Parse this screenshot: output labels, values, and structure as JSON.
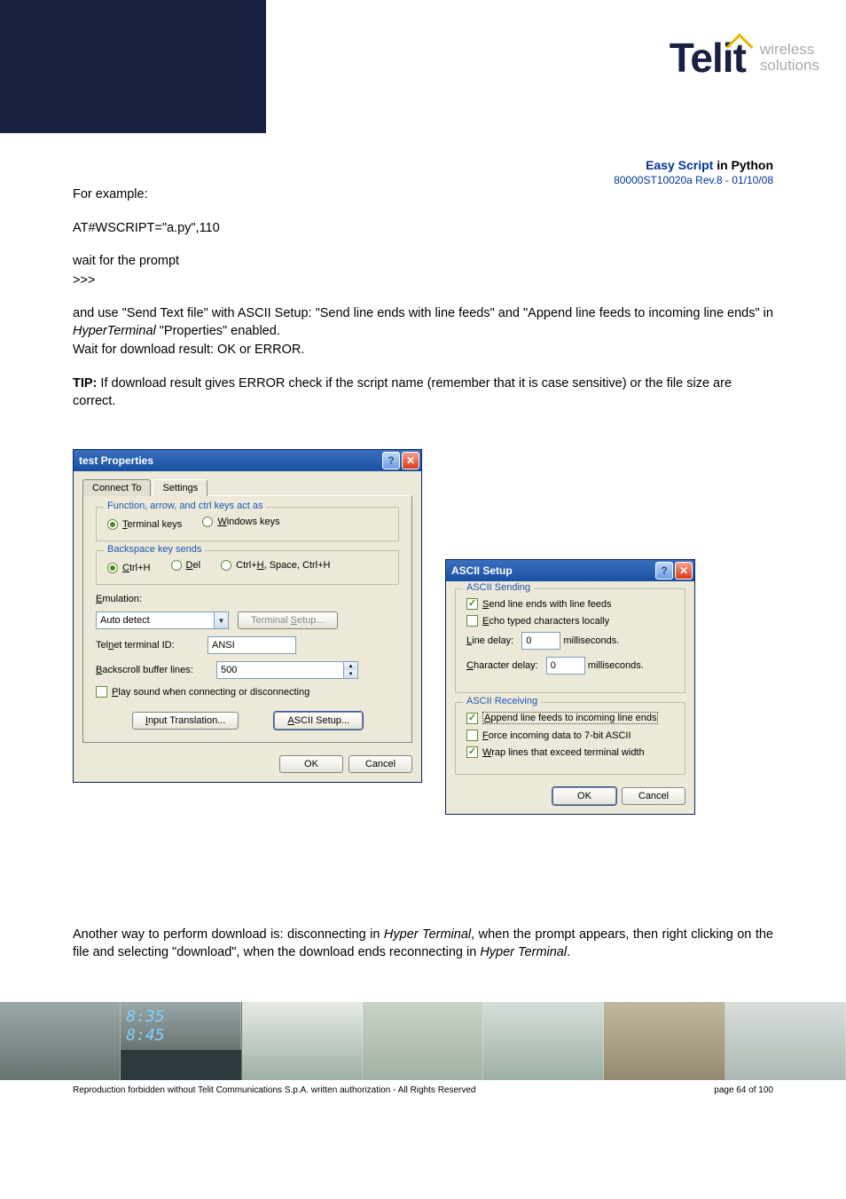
{
  "logo": {
    "brand": "Telit",
    "sub1": "wireless",
    "sub2": "solutions"
  },
  "meta": {
    "title_prefix": "Easy Script",
    "title_suffix": " in Python",
    "rev": "80000ST10020a Rev.8 - 01/10/08"
  },
  "body": {
    "p1": "For example:",
    "p2": "AT#WSCRIPT=\"a.py\",110",
    "p3a": "wait for the prompt",
    "p3b": ">>>",
    "p4": "and use \"Send Text file\" with ASCII Setup: \"Send line ends with line feeds\" and \"Append line feeds to incoming line ends\" in ",
    "p4i": "HyperTerminal",
    "p4b": " \"Properties\" enabled.",
    "p5": "Wait for download result: OK or ERROR.",
    "tip_label": "TIP:",
    "tip_text": " If download result gives ERROR check if the script name (remember that it is case sensitive) or the file size are correct.",
    "after1": "Another way to perform download is: disconnecting in ",
    "after1i": "Hyper Terminal",
    "after2": ", when the prompt appears, then right clicking on the file and selecting \"download\", when the download ends reconnecting in ",
    "after2i": "Hyper Terminal",
    "after3": "."
  },
  "dialog1": {
    "title": "test Properties",
    "tab1": "Connect To",
    "tab2": "Settings",
    "group1_legend": "Function, arrow, and ctrl keys act as",
    "opt_terminal": "Terminal keys",
    "opt_windows": "Windows keys",
    "group2_legend": "Backspace key sends",
    "opt_ctrlh": "Ctrl+H",
    "opt_del": "Del",
    "opt_combo": "Ctrl+H, Space, Ctrl+H",
    "emulation_label": "Emulation:",
    "emulation_value": "Auto detect",
    "termsetup_btn": "Terminal Setup...",
    "telnet_label": "Telnet terminal ID:",
    "telnet_value": "ANSI",
    "backscroll_label": "Backscroll buffer lines:",
    "backscroll_value": "500",
    "playsound": "Play sound when connecting or disconnecting",
    "inputtrans_btn": "Input Translation...",
    "ascii_btn": "ASCII Setup...",
    "ok": "OK",
    "cancel": "Cancel"
  },
  "dialog2": {
    "title": "ASCII Setup",
    "group1": "ASCII Sending",
    "cb_sendline": "Send line ends with line feeds",
    "cb_echo": "Echo typed characters locally",
    "linedelay_label": "Line delay:",
    "linedelay_val": "0",
    "ms": "milliseconds.",
    "chardelay_label": "Character delay:",
    "chardelay_val": "0",
    "group2": "ASCII Receiving",
    "cb_append": "Append line feeds to incoming line ends",
    "cb_force": "Force incoming data to 7-bit ASCII",
    "cb_wrap": "Wrap lines that exceed terminal width",
    "ok": "OK",
    "cancel": "Cancel"
  },
  "footer": {
    "clock1": "8:35",
    "clock2": "8:45"
  },
  "copyright": {
    "text": "Reproduction forbidden without Telit Communications S.p.A. written authorization - All Rights Reserved",
    "page": "page 64 of 100"
  }
}
